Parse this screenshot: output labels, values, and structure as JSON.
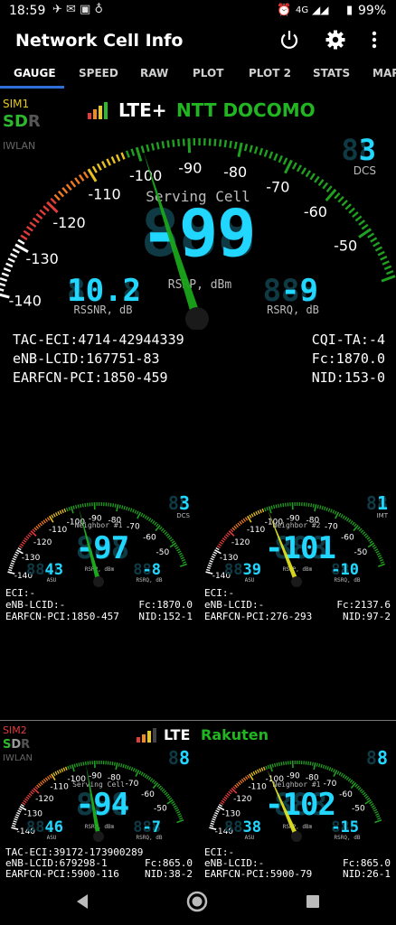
{
  "status": {
    "time": "18:59",
    "network": "4G",
    "battery": "99%"
  },
  "app": {
    "title": "Network Cell Info"
  },
  "tabs": [
    "GAUGE",
    "SPEED",
    "RAW",
    "PLOT",
    "PLOT 2",
    "STATS",
    "MAP"
  ],
  "sim1": {
    "label": "SIM1",
    "s": "S",
    "d": "D",
    "r": "R",
    "iwlan": "IWLAN",
    "tech": "LTE+",
    "operator": "NTT DOCOMO",
    "signal_level": 4,
    "gauge": {
      "title": "Serving Cell",
      "value": "-99",
      "unit": "dBm",
      "metric": "RSRP",
      "needle_dbm": -99,
      "ticks": [
        "-140",
        "-130",
        "-120",
        "-110",
        "-100",
        "-90",
        "-80",
        "-70",
        "-60",
        "-50"
      ],
      "dcs": "3",
      "dcs_label": "DCS",
      "rssnr": "10.2",
      "rssnr_label": "RSSNR, dB",
      "rsrq": "-9",
      "rsrq_label": "RSRQ, dB"
    },
    "info_left": [
      "TAC-ECI:4714-42944339",
      "eNB-LCID:167751-83",
      "EARFCN-PCI:1850-459"
    ],
    "info_right": [
      "CQI-TA:-4",
      "Fc:1870.0",
      "NID:153-0"
    ]
  },
  "neighbors": [
    {
      "title": "Neighbor #1",
      "value": "-97",
      "needle_dbm": -97,
      "asu": "43",
      "rsrq": "-8",
      "corner": "3",
      "corner_label": "DCS",
      "ticks": [
        "-140",
        "-130",
        "-120",
        "-110",
        "-100",
        "-90",
        "-80",
        "-70",
        "-60",
        "-50"
      ],
      "eci": "ECI:-",
      "enb": "eNB-LCID:-",
      "earfcn": "EARFCN-PCI:1850-457",
      "fc": "Fc:1870.0",
      "nid": "NID:152-1",
      "color": "#1fae1f"
    },
    {
      "title": "Neighbor #2",
      "value": "-101",
      "needle_dbm": -101,
      "asu": "39",
      "rsrq": "-10",
      "corner": "1",
      "corner_label": "IMT",
      "ticks": [
        "-140",
        "-130",
        "-120",
        "-110",
        "-100",
        "-90",
        "-80",
        "-70",
        "-60",
        "-50"
      ],
      "eci": "ECI:-",
      "enb": "eNB-LCID:-",
      "earfcn": "EARFCN-PCI:276-293",
      "fc": "Fc:2137.6",
      "nid": "NID:97-2",
      "color": "#e0e020"
    }
  ],
  "sim2": {
    "label": "SIM2",
    "s": "S",
    "d": "D",
    "r": "R",
    "iwlan": "IWLAN",
    "tech": "LTE",
    "operator": "Rakuten",
    "signal_level": 3,
    "gauges": [
      {
        "title": "Serving Cell",
        "value": "-94",
        "needle_dbm": -94,
        "asu": "46",
        "rsrq": "-7",
        "corner": "8",
        "ticks": [
          "-140",
          "-130",
          "-120",
          "-110",
          "-100",
          "-90",
          "-80",
          "-70",
          "-60",
          "-50"
        ],
        "eci": "TAC-ECI:39172-173900289",
        "enb": "eNB-LCID:679298-1",
        "earfcn": "EARFCN-PCI:5900-116",
        "fc": "Fc:865.0",
        "nid": "NID:38-2",
        "color": "#1fae1f"
      },
      {
        "title": "Neighbor #1",
        "value": "-102",
        "needle_dbm": -102,
        "asu": "38",
        "rsrq": "-15",
        "corner": "8",
        "ticks": [
          "-140",
          "-130",
          "-120",
          "-110",
          "-100",
          "-90",
          "-80",
          "-70",
          "-60",
          "-50"
        ],
        "eci": "ECI:-",
        "enb": "eNB-LCID:-",
        "earfcn": "EARFCN-PCI:5900-79",
        "fc": "Fc:865.0",
        "nid": "NID:26-1",
        "color": "#e0e020"
      }
    ]
  },
  "colors": {
    "green": "#2eb82e",
    "operator_green": "#22b522",
    "digit_cyan": "#21d6ff",
    "digit_dim": "#0f3a44",
    "accent": "#2f6fd8",
    "sim_label": "#e6c81e",
    "sim2_label": "#e03c3c"
  }
}
